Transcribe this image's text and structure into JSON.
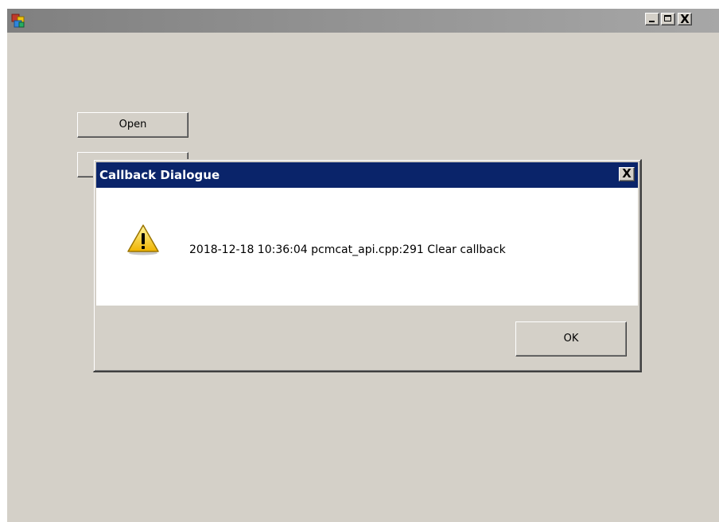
{
  "main_window": {
    "title": "",
    "app_icon": "application-cubes-icon",
    "buttons": {
      "open_label": "Open",
      "second_label": ""
    },
    "caption_buttons": {
      "minimize_icon": "minimize-icon",
      "maximize_icon": "maximize-icon",
      "close_label": "X"
    }
  },
  "dialog": {
    "title": "Callback Dialogue",
    "close_label": "X",
    "message": "2018-12-18 10:36:04 pcmcat_api.cpp:291 Clear callback",
    "icon": "warning-icon",
    "ok_label": "OK"
  },
  "colors": {
    "dialog_titlebar": "#0a246a",
    "face": "#d4d0c8",
    "main_titlebar": "#808080"
  }
}
